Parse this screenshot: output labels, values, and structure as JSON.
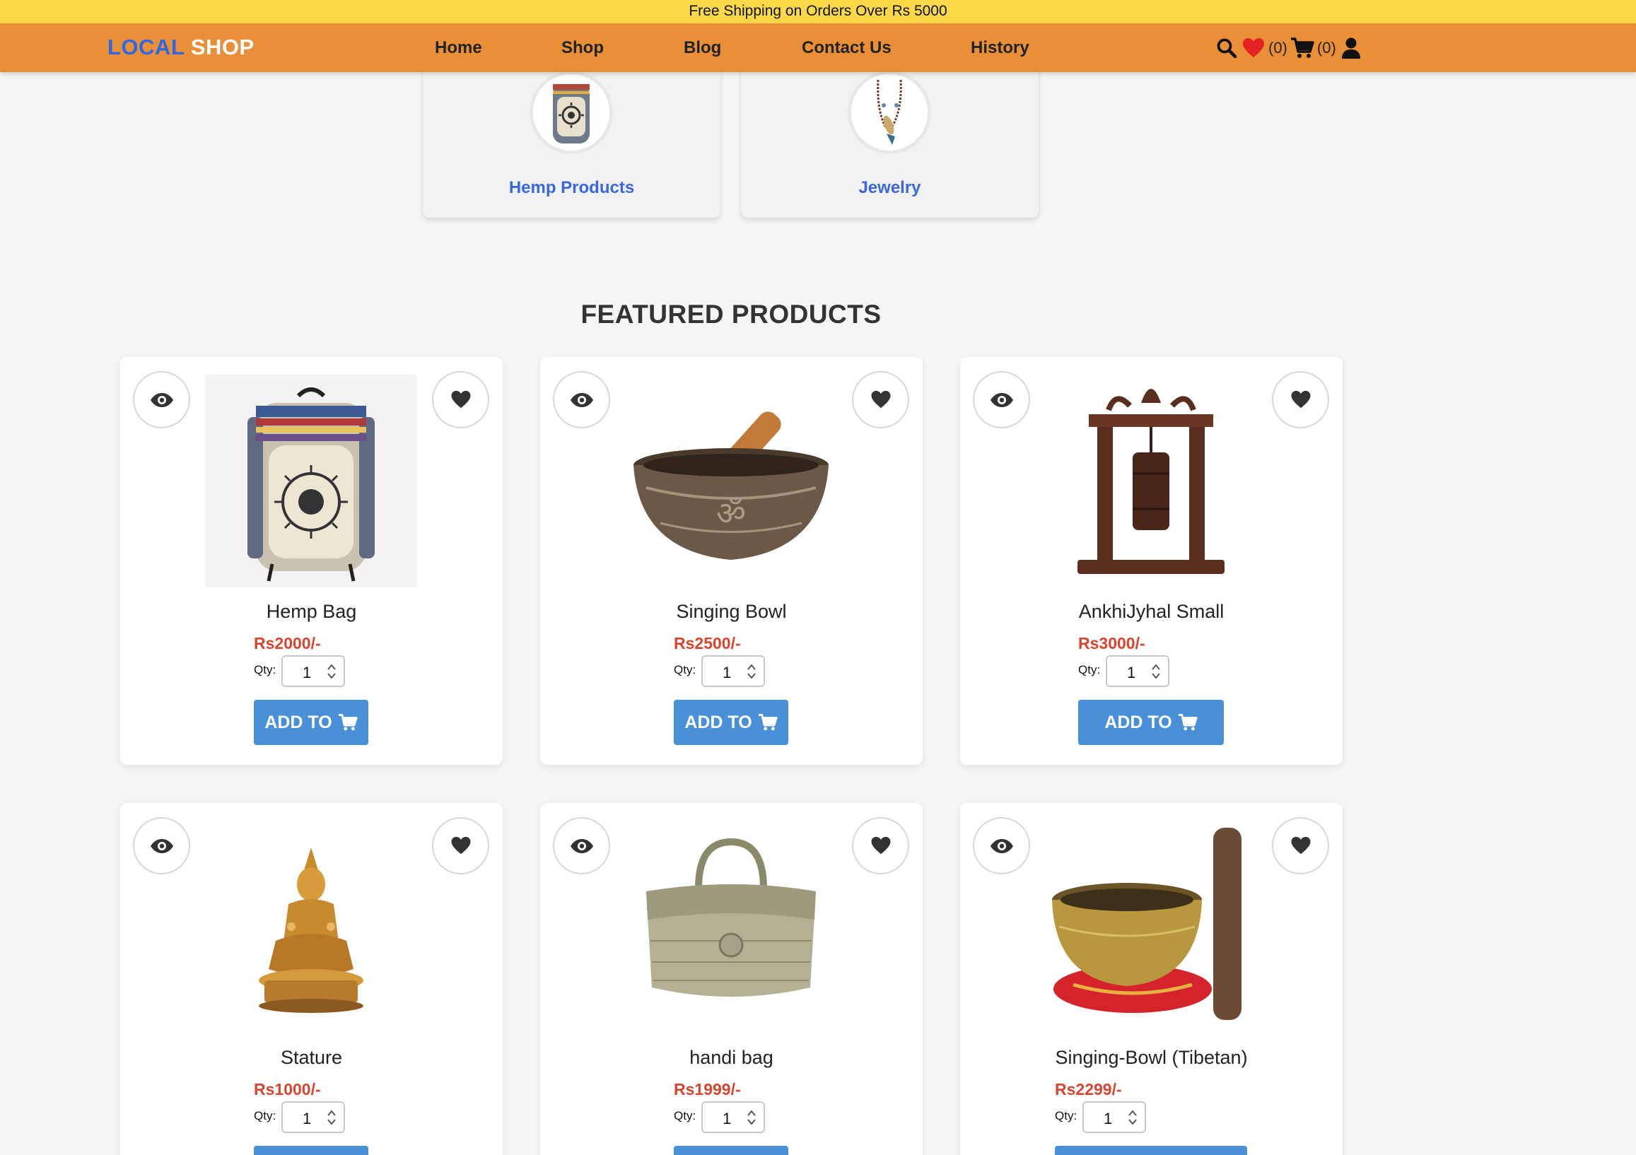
{
  "promo": {
    "text": "Free Shipping on Orders Over Rs 5000"
  },
  "header": {
    "logo_part1": "LOCAL",
    "logo_part2": "SHOP",
    "nav": [
      "Home",
      "Shop",
      "Blog",
      "Contact Us",
      "History"
    ],
    "wishlist_count": "(0)",
    "cart_count": "(0)"
  },
  "categories": [
    {
      "label": "Hemp Products",
      "icon": "backpack"
    },
    {
      "label": "Jewelry",
      "icon": "necklace"
    }
  ],
  "featured": {
    "title": "FEATURED PRODUCTS",
    "qty_label": "Qty:",
    "add_label": "ADD TO",
    "products": [
      {
        "name": "Hemp Bag",
        "price": "Rs2000/-",
        "qty": "1",
        "image": "hemp-backpack"
      },
      {
        "name": "Singing Bowl",
        "price": "Rs2500/-",
        "qty": "1",
        "image": "singing-bowl-with-stick"
      },
      {
        "name": "AnkhiJyhal Small",
        "price": "Rs3000/-",
        "qty": "1",
        "image": "wooden-prayer-wheel-stand"
      },
      {
        "name": "Stature",
        "price": "Rs1000/-",
        "qty": "1",
        "image": "golden-buddha-statue"
      },
      {
        "name": "handi bag",
        "price": "Rs1999/-",
        "qty": "1",
        "image": "woven-basket-bag"
      },
      {
        "name": "Singing-Bowl (Tibetan)",
        "price": "Rs2299/-",
        "qty": "1",
        "image": "tibetan-singing-bowl-on-cushion"
      }
    ]
  },
  "colors": {
    "promo_bg": "#fad848",
    "nav_bg": "#e98f37",
    "logo_blue": "#2f67e4",
    "price_red": "#d9442f",
    "button_blue": "#4a90d9",
    "heart_red": "#e52222"
  }
}
